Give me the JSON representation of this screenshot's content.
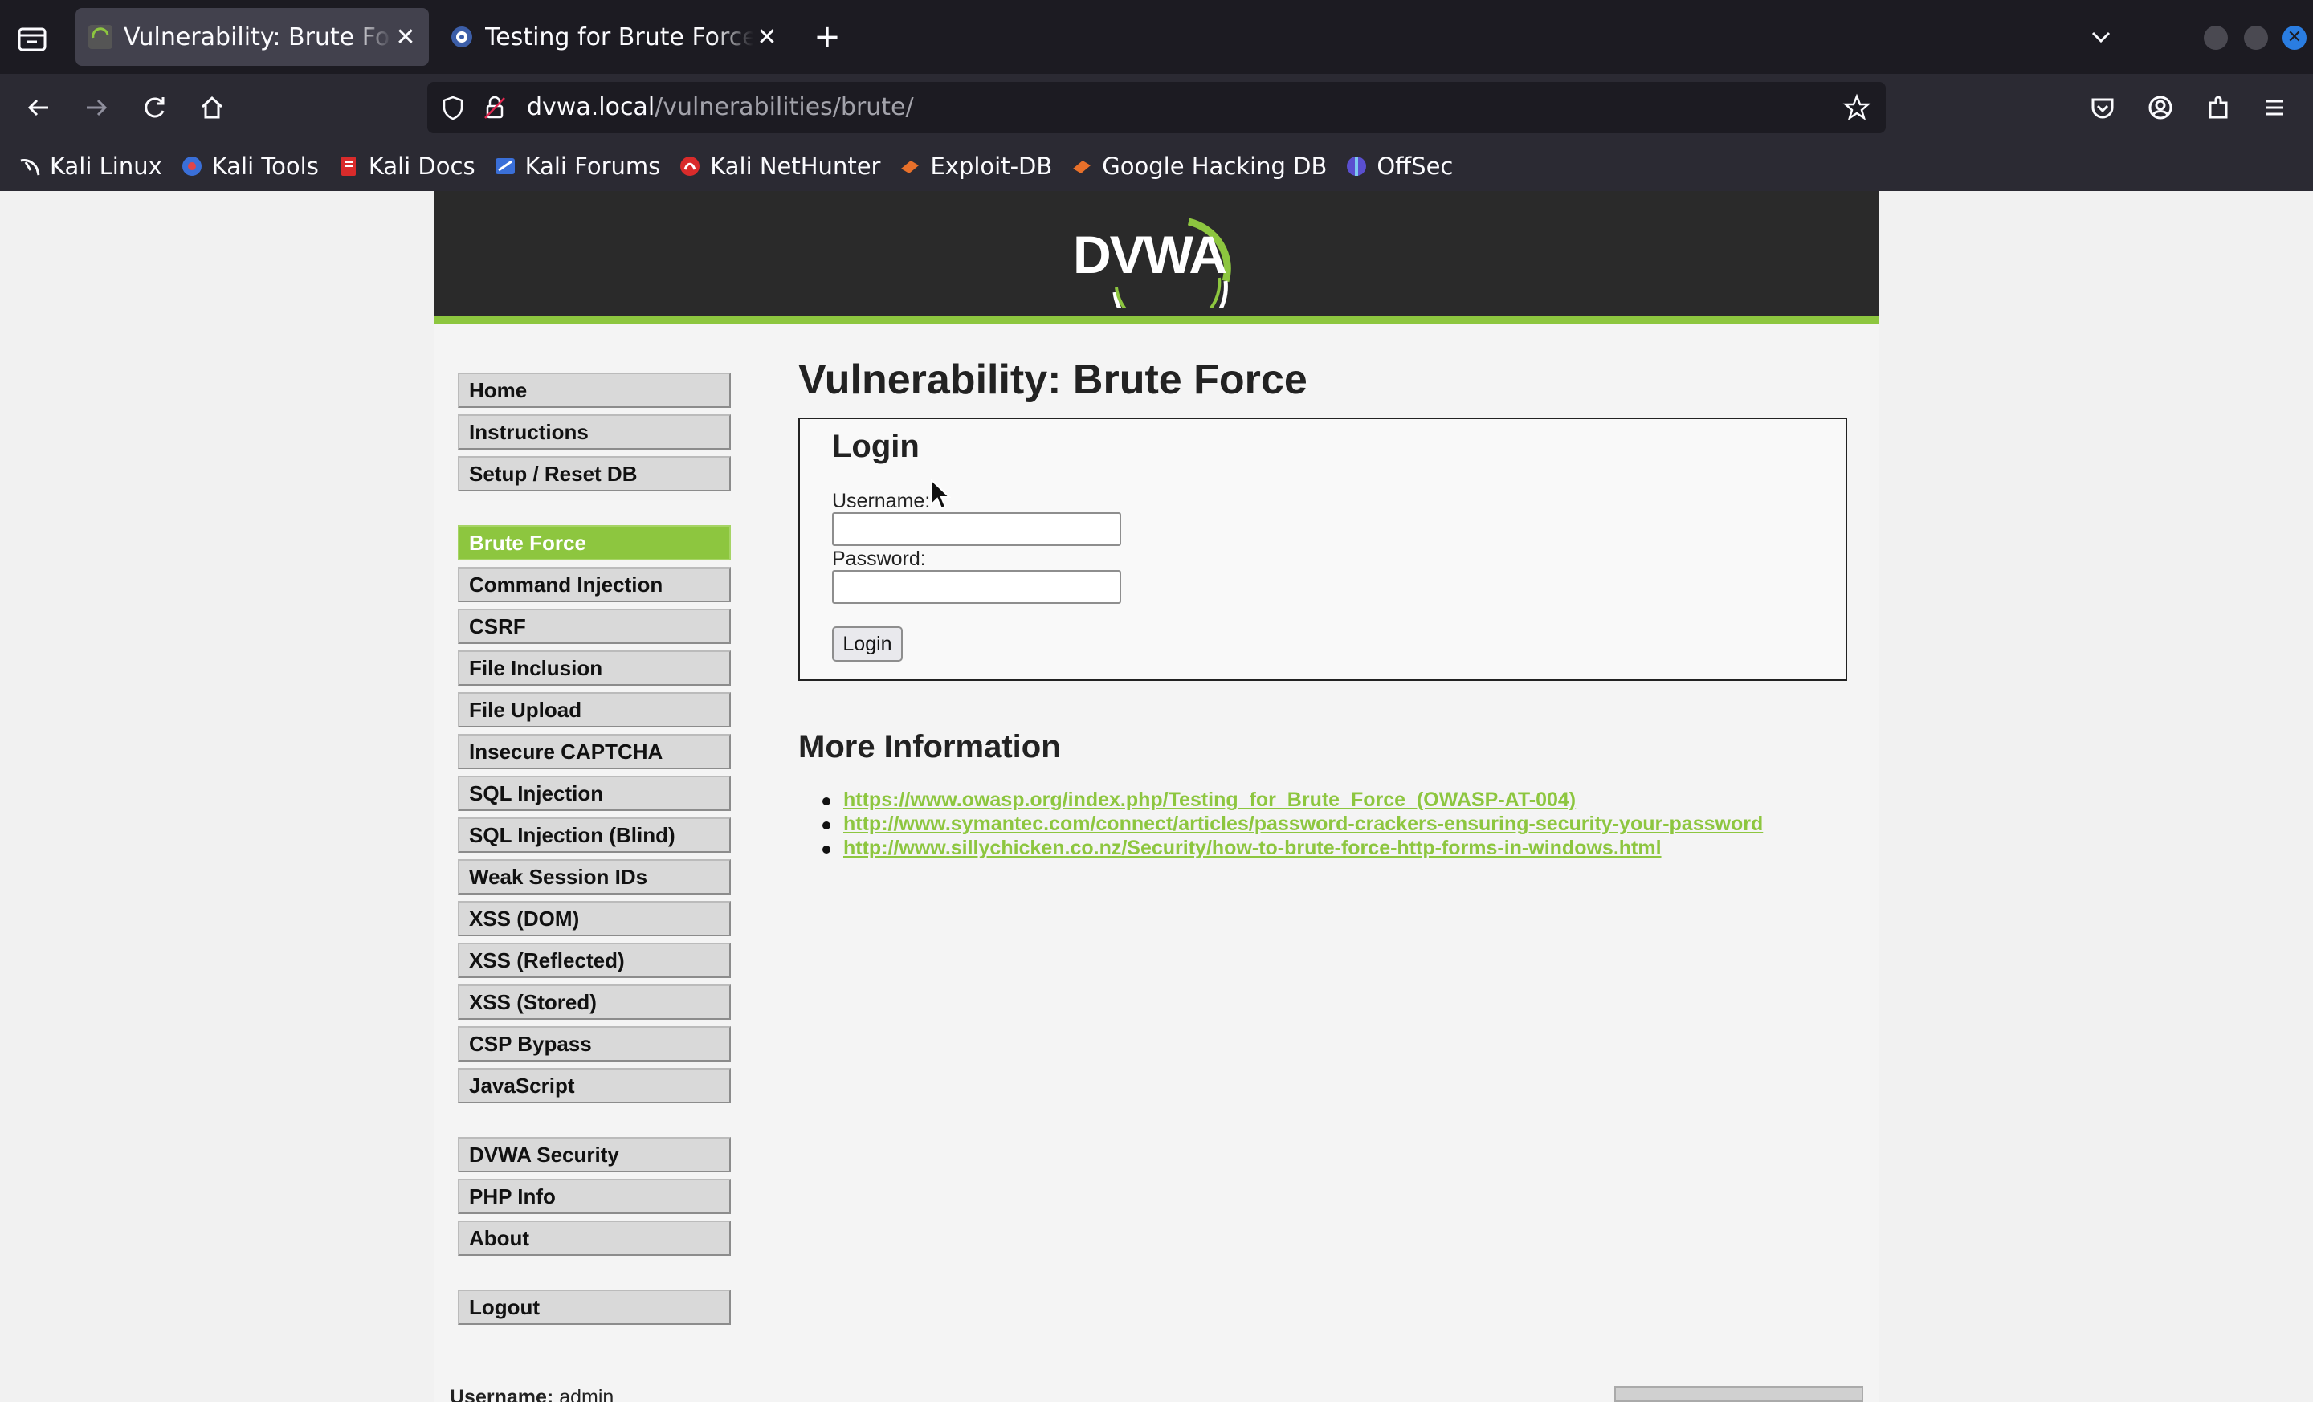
{
  "browser": {
    "tabs": [
      {
        "title": "Vulnerability: Brute Force",
        "active": true
      },
      {
        "title": "Testing for Brute Force (O",
        "active": false
      }
    ],
    "url_host": "dvwa.local",
    "url_path": "/vulnerabilities/brute/",
    "bookmarks": [
      "Kali Linux",
      "Kali Tools",
      "Kali Docs",
      "Kali Forums",
      "Kali NetHunter",
      "Exploit-DB",
      "Google Hacking DB",
      "OffSec"
    ]
  },
  "site": {
    "logo_text": "DVWA",
    "accent_color": "#8dc63f"
  },
  "menu": {
    "group1": [
      "Home",
      "Instructions",
      "Setup / Reset DB"
    ],
    "group2": [
      "Brute Force",
      "Command Injection",
      "CSRF",
      "File Inclusion",
      "File Upload",
      "Insecure CAPTCHA",
      "SQL Injection",
      "SQL Injection (Blind)",
      "Weak Session IDs",
      "XSS (DOM)",
      "XSS (Reflected)",
      "XSS (Stored)",
      "CSP Bypass",
      "JavaScript"
    ],
    "group3": [
      "DVWA Security",
      "PHP Info",
      "About"
    ],
    "group4": [
      "Logout"
    ],
    "selected": "Brute Force"
  },
  "main": {
    "title": "Vulnerability: Brute Force",
    "login": {
      "heading": "Login",
      "username_label": "Username:",
      "username_value": "",
      "password_label": "Password:",
      "password_value": "",
      "button": "Login"
    },
    "more_info_heading": "More Information",
    "links": [
      "https://www.owasp.org/index.php/Testing_for_Brute_Force_(OWASP-AT-004)",
      "http://www.symantec.com/connect/articles/password-crackers-ensuring-security-your-password",
      "http://www.sillychicken.co.nz/Security/how-to-brute-force-http-forms-in-windows.html"
    ]
  },
  "footer": {
    "username_label": "Username:",
    "username_value": "admin"
  }
}
